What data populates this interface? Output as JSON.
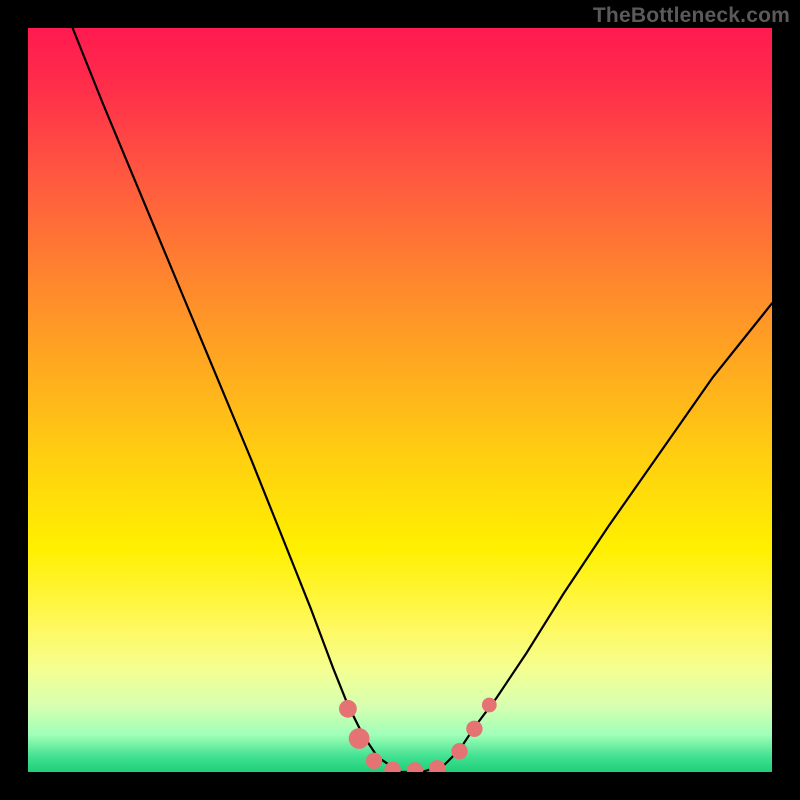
{
  "watermark": "TheBottleneck.com",
  "chart_data": {
    "type": "line",
    "title": "",
    "xlabel": "",
    "ylabel": "",
    "xlim": [
      0,
      100
    ],
    "ylim": [
      0,
      100
    ],
    "series": [
      {
        "name": "bottleneck-curve",
        "x": [
          6,
          10,
          15,
          20,
          25,
          30,
          34,
          38,
          41,
          43,
          45,
          47,
          50,
          53,
          56,
          58,
          60,
          63,
          67,
          72,
          78,
          85,
          92,
          100
        ],
        "values": [
          100,
          90,
          78,
          66,
          54,
          42,
          32,
          22,
          14,
          9,
          5,
          2,
          0,
          0,
          1,
          3,
          6,
          10,
          16,
          24,
          33,
          43,
          53,
          63
        ]
      }
    ],
    "markers": [
      {
        "name": "dot-left-upper",
        "x": 43.0,
        "y": 8.5,
        "r": 1.2
      },
      {
        "name": "dot-left-mid",
        "x": 44.5,
        "y": 4.5,
        "r": 1.4
      },
      {
        "name": "dot-left-lower",
        "x": 46.5,
        "y": 1.5,
        "r": 1.1
      },
      {
        "name": "dot-valley-a",
        "x": 49.0,
        "y": 0.3,
        "r": 1.1
      },
      {
        "name": "dot-valley-b",
        "x": 52.0,
        "y": 0.2,
        "r": 1.1
      },
      {
        "name": "dot-valley-c",
        "x": 55.0,
        "y": 0.5,
        "r": 1.1
      },
      {
        "name": "dot-right-lower",
        "x": 58.0,
        "y": 2.8,
        "r": 1.1
      },
      {
        "name": "dot-right-mid",
        "x": 60.0,
        "y": 5.8,
        "r": 1.1
      },
      {
        "name": "dot-right-upper",
        "x": 62.0,
        "y": 9.0,
        "r": 1.0
      }
    ],
    "marker_color": "#e57373",
    "curve_color": "#000000",
    "curve_width": 2.2
  }
}
